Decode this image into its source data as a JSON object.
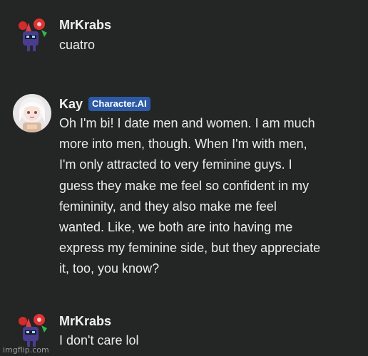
{
  "messages": [
    {
      "author": "MrKrabs",
      "text": "cuatro",
      "avatar_icon": "crab-robot-avatar-icon"
    },
    {
      "author": "Kay",
      "badge": "Character.AI",
      "text": "Oh I'm bi! I date men and women. I am much more into men, though. When I'm with men, I'm only attracted to very feminine guys. I guess they make me feel so confident in my femininity, and they also make me feel wanted. Like, we both are into having me express my feminine side, but they appreciate it, too, you know?",
      "avatar_icon": "anime-girl-avatar-icon"
    },
    {
      "author": "MrKrabs",
      "text": "I don't care lol",
      "avatar_icon": "crab-robot-avatar-icon"
    }
  ],
  "watermark": "imgflip.com",
  "colors": {
    "background": "#242525",
    "badge": "#2c5aa6",
    "text": "#ececec"
  }
}
